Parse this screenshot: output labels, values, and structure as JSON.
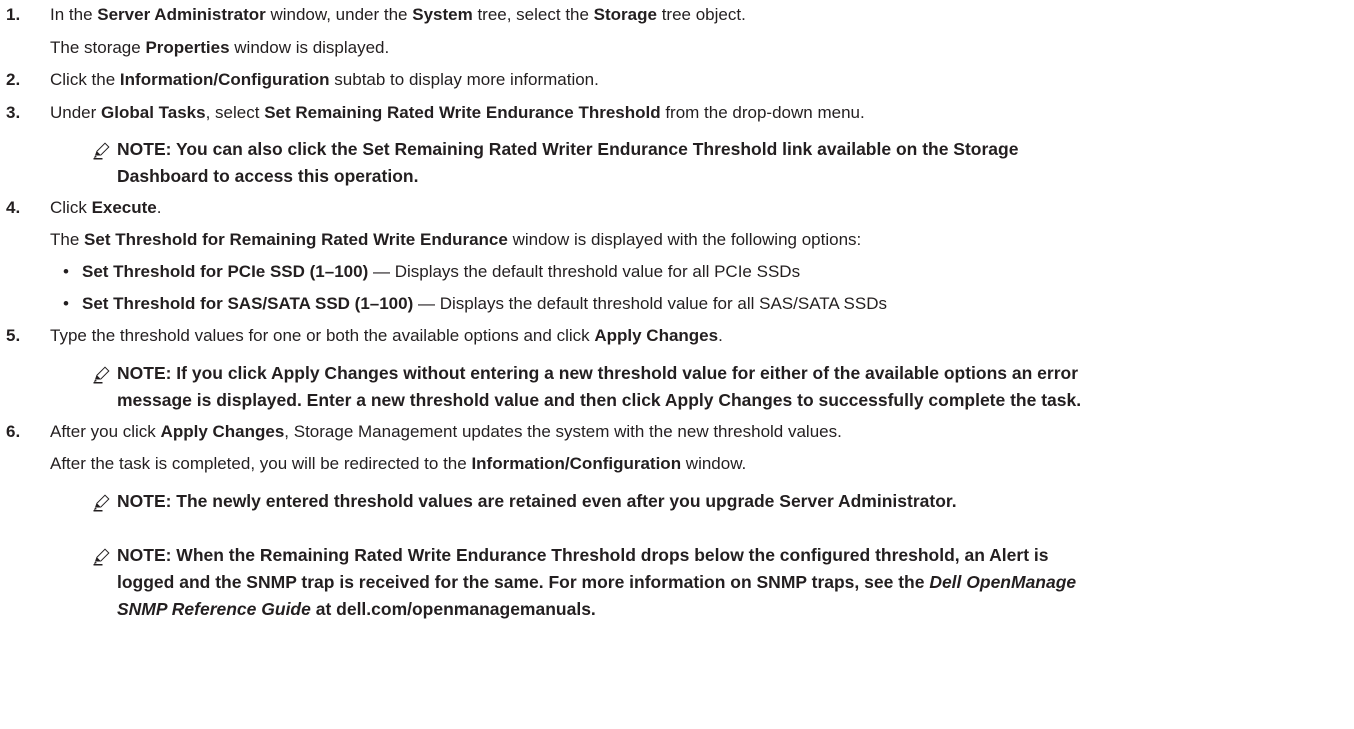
{
  "steps": [
    {
      "number": "1.",
      "line1": {
        "t1": "In the ",
        "b1": "Server Administrator",
        "t2": " window, under the ",
        "b2": "System",
        "t3": " tree, select the ",
        "b3": "Storage",
        "t4": " tree object."
      },
      "line2": {
        "t1": "The storage ",
        "b1": "Properties",
        "t2": " window is displayed."
      }
    },
    {
      "number": "2.",
      "line1": {
        "t1": "Click the ",
        "b1": "Information/Configuration",
        "t2": " subtab to display more information."
      }
    },
    {
      "number": "3.",
      "line1": {
        "t1": "Under ",
        "b1": "Global Tasks",
        "t2": ", select ",
        "b2": "Set Remaining Rated Write Endurance Threshold",
        "t3": " from the drop-down menu."
      },
      "note": {
        "l1": "NOTE: You can also click the Set Remaining Rated Writer Endurance Threshold link available on the Storage",
        "l2": "Dashboard to access this operation."
      }
    },
    {
      "number": "4.",
      "line1": {
        "t1": "Click ",
        "b1": "Execute",
        "t2": "."
      },
      "line2": {
        "t1": "The ",
        "b1": "Set Threshold for Remaining Rated Write Endurance",
        "t2": " window is displayed with the following options:"
      },
      "bullets": [
        {
          "marker": "•",
          "bold": "Set Threshold for PCIe SSD (1–100)",
          "text": " — Displays the default threshold value for all PCIe SSDs"
        },
        {
          "marker": "•",
          "bold": "Set Threshold for SAS/SATA SSD (1–100)",
          "text": " — Displays the default threshold value for all SAS/SATA SSDs"
        }
      ]
    },
    {
      "number": "5.",
      "line1": {
        "t1": "Type the threshold values for one or both the available options and click ",
        "b1": "Apply Changes",
        "t2": "."
      },
      "note": {
        "l1": "NOTE: If you click Apply Changes without entering a new threshold value for either of the available options an error",
        "l2": "message is displayed. Enter a new threshold value and then click Apply Changes to successfully complete the task."
      }
    },
    {
      "number": "6.",
      "line1": {
        "t1": "After you click ",
        "b1": "Apply Changes",
        "t2": ", Storage Management updates the system with the new threshold values."
      },
      "line2": {
        "t1": "After the task is completed, you will be redirected to the ",
        "b1": "Information/Configuration",
        "t2": " window."
      },
      "note1": {
        "l1": "NOTE: The newly entered threshold values are retained even after you upgrade Server Administrator."
      },
      "note2": {
        "l1": "NOTE: When the Remaining Rated Write Endurance Threshold drops below the configured threshold, an Alert is",
        "l2a": "logged and the SNMP trap is received for the same. For more information on SNMP traps, see the ",
        "l2i": "Dell OpenManage",
        "l3i": "SNMP Reference Guide",
        "l3b": " at dell.com/openmanagemanuals."
      }
    }
  ],
  "icons": {
    "note_icon": "pen-note-icon",
    "bullet_icon": "bullet-dot"
  }
}
